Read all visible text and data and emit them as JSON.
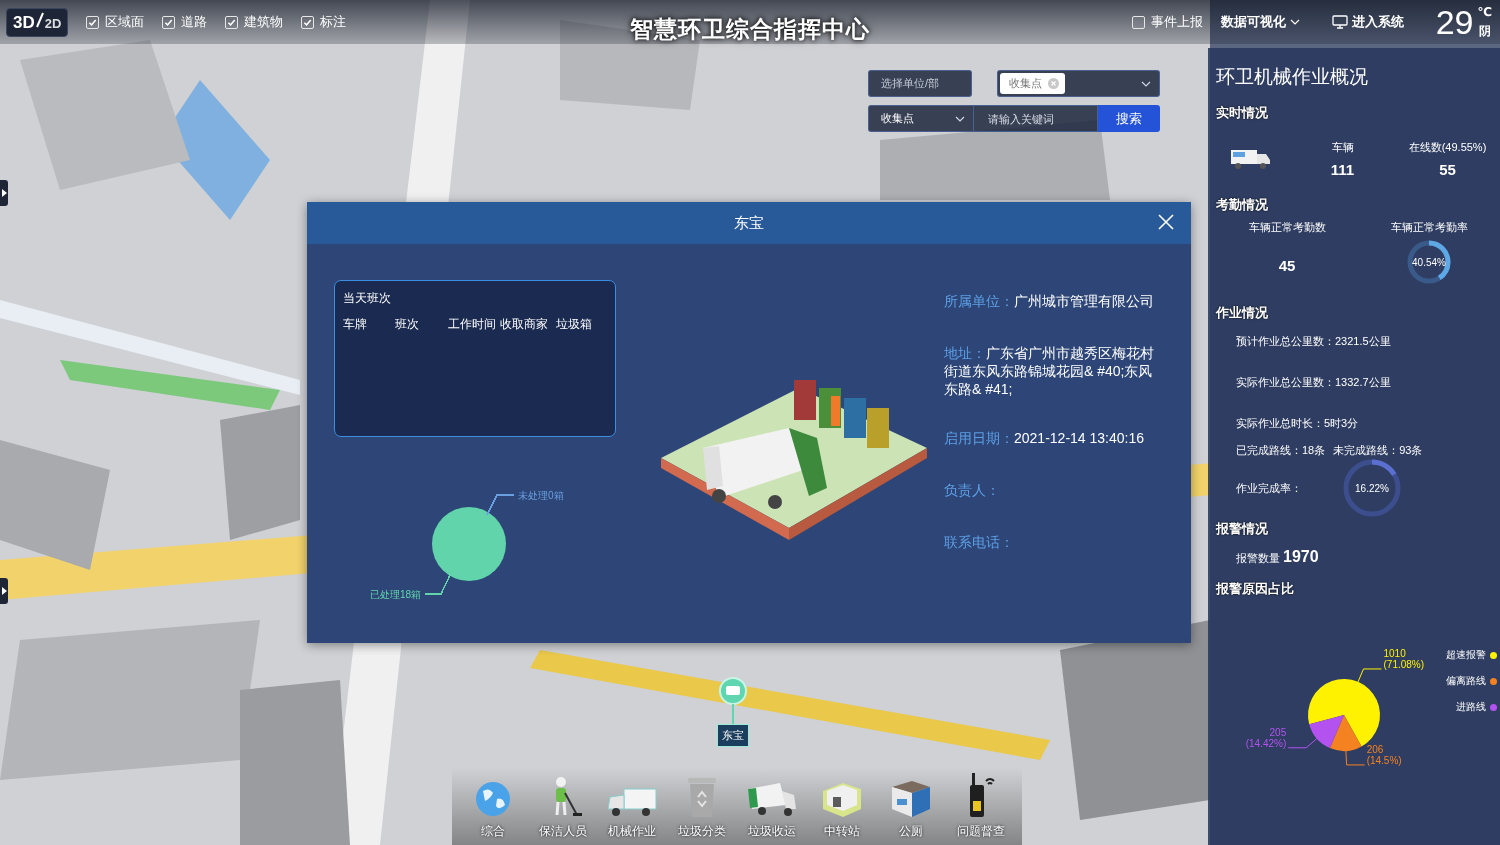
{
  "top_bar": {
    "view_toggle": [
      {
        "label": "3D",
        "selected": true
      },
      {
        "label": "2D",
        "selected": false
      }
    ],
    "layers": [
      {
        "label": "区域面",
        "checked": true
      },
      {
        "label": "道路",
        "checked": true
      },
      {
        "label": "建筑物",
        "checked": true
      },
      {
        "label": "标注",
        "checked": true
      }
    ],
    "title": "智慧环卫综合指挥中心",
    "event_report": {
      "label": "事件上报",
      "checked": false
    },
    "data_menu": "数据可视化",
    "enter_button": "进入系统",
    "weather": {
      "temperature": "29",
      "unit": "℃",
      "condition": "阴"
    }
  },
  "search": {
    "unit_select": {
      "placeholder": "选择单位/部"
    },
    "type_tags": [
      "收集点"
    ],
    "category_select": "收集点",
    "keyword": {
      "placeholder": "请输入关键词"
    },
    "button": "搜索"
  },
  "right_panel": {
    "title": "环卫机械作业概况",
    "realtime": {
      "heading": "实时情况",
      "stats": [
        {
          "label": "车辆",
          "value": "111"
        },
        {
          "label": "在线数(49.55%)",
          "value": "55"
        }
      ]
    },
    "attendance": {
      "heading": "考勤情况",
      "count_label": "车辆正常考勤数",
      "count": "45",
      "rate_label": "车辆正常考勤率",
      "rate": "40.54%",
      "level": 0.4054
    },
    "work": {
      "heading": "作业情况",
      "lines": [
        "预计作业总公里数：2321.5公里",
        "实际作业总公里数：1332.7公里",
        "实际作业总时长：5时3分"
      ],
      "routes": [
        "已完成路线：18条",
        "未完成路线：93条"
      ],
      "completion_label": "作业完成率：",
      "completion": "16.22%",
      "level": 0.1622
    },
    "alarms": {
      "heading": "报警情况",
      "count_label": "报警数量",
      "count": "1970"
    },
    "reasons": {
      "heading": "报警原因占比",
      "chart_data": {
        "type": "pie",
        "categories": [
          "超速报警",
          "偏离路线",
          "进路线"
        ],
        "colors": [
          "#fff200",
          "#f58220",
          "#b452f0"
        ],
        "legend": "right",
        "series": [
          {
            "values": [
              1010,
              206,
              205
            ]
          }
        ],
        "data_labels": true,
        "value_labels": [
          "(71.08%)",
          "(14.5%)",
          "(14.42%)"
        ]
      }
    }
  },
  "dialog": {
    "title": "东宝",
    "shift_table": {
      "heading": "当天班次",
      "columns": [
        "车牌",
        "班次",
        "工作时间",
        "收取商家",
        "垃圾箱"
      ]
    },
    "bins_chart": {
      "labels": [
        {
          "text": "已处理18箱",
          "color": "#62d4ac"
        },
        {
          "text": "未处理0箱",
          "color": "#6a9fe0"
        }
      ]
    },
    "fields": [
      {
        "label": "所属单位：",
        "value": "广州城市管理有限公司"
      },
      {
        "label": "地址：",
        "value": "广东省广州市越秀区梅花村街道东风东路锦城花园& #40;东风东路& #41;"
      },
      {
        "label": "启用日期：",
        "value": "2021-12-14 13:40:16"
      },
      {
        "label": "负责人："
      },
      {
        "label": "联系电话："
      }
    ]
  },
  "map_marker": {
    "label": "东宝"
  },
  "bottom_toolbar": [
    {
      "label": "综合"
    },
    {
      "label": "保洁人员"
    },
    {
      "label": "机械作业"
    },
    {
      "label": "垃圾分类"
    },
    {
      "label": "垃圾收运"
    },
    {
      "label": "中转站"
    },
    {
      "label": "公厕"
    },
    {
      "label": "问题督查"
    }
  ]
}
